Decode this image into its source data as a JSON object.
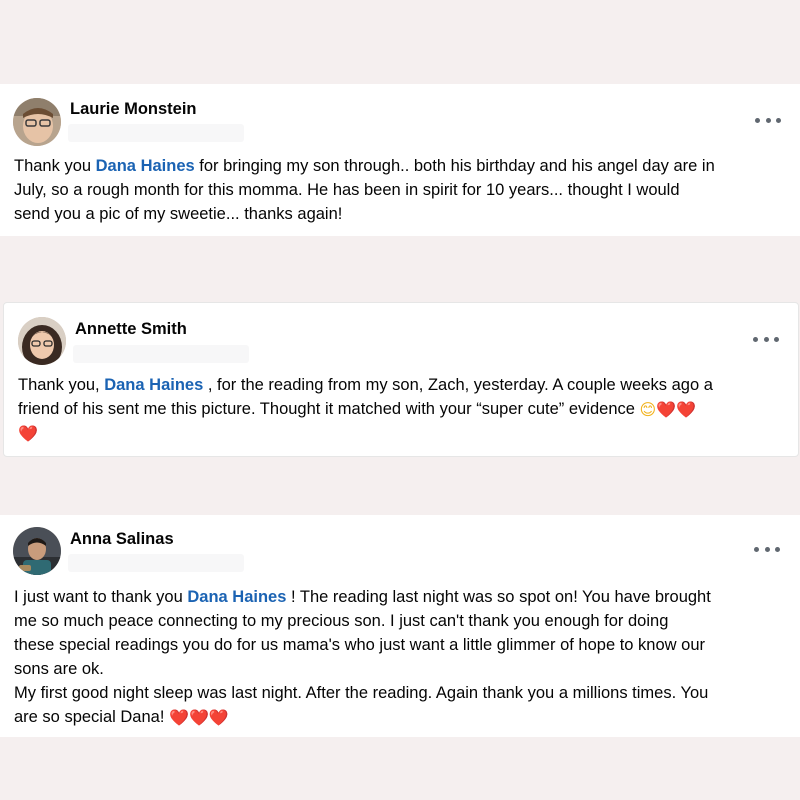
{
  "posts": [
    {
      "author": "Laurie Monstein",
      "mention": "Dana Haines",
      "lines": [
        {
          "before": "Thank you ",
          "after": " for bringing my son through..  both his birthday and his angel day are in"
        },
        {
          "text": "July, so a rough month for this momma. He has been in spirit for 10 years... thought I would"
        },
        {
          "text": "send you a pic of my sweetie... thanks again!"
        }
      ]
    },
    {
      "author": "Annette Smith",
      "mention": "Dana Haines",
      "lines": [
        {
          "before": "Thank you, ",
          "after": " , for the reading from my son, Zach, yesterday. A couple weeks ago a"
        },
        {
          "text": "friend of his sent me this picture. Thought it matched with your “super cute” evidence "
        }
      ],
      "emojis_line2": [
        "😊",
        "❤️",
        "❤️"
      ],
      "emojis_line3": [
        "❤️"
      ]
    },
    {
      "author": "Anna Salinas",
      "mention": "Dana Haines",
      "lines": [
        {
          "before": "I just want to thank you ",
          "after": " ! The reading last night was so spot on! You have brought"
        },
        {
          "text": "me so much peace connecting to my precious son.  I just can't thank you enough for doing"
        },
        {
          "text": "these special readings you do for us mama's who just want a little glimmer of hope to know our"
        },
        {
          "text": "sons are ok."
        },
        {
          "text": "My first good night sleep was last night. After the reading.  Again thank you a millions times. You"
        },
        {
          "text": "are so special Dana! "
        }
      ],
      "emojis_last": [
        "❤️",
        "❤️",
        "❤️"
      ]
    }
  ],
  "more_icon": "more-horizontal-icon",
  "colors": {
    "background": "#f5efef",
    "card": "#ffffff",
    "mention": "#1b63b3",
    "heart": "#e0152b"
  }
}
